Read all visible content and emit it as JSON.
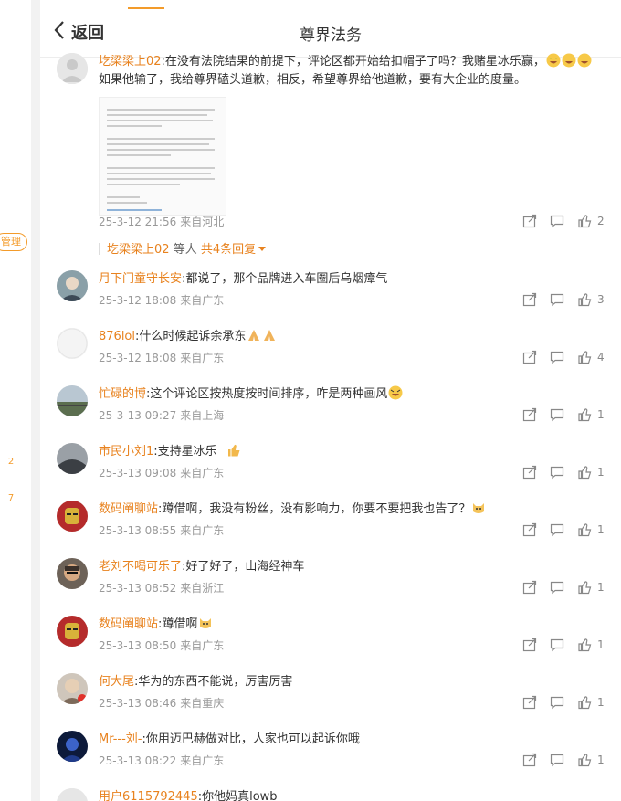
{
  "header": {
    "back_label": "返回",
    "title": "尊界法务"
  },
  "gutter": {
    "manage_label": "管理",
    "count_a": "2",
    "count_b": "7"
  },
  "comments": [
    {
      "user": "圪梁梁上02",
      "text": ":在没有法院结果的前提下，评论区都开始给扣帽子了吗？我赌星冰乐赢，",
      "text2": "如果他输了，我给尊界磕头道歉，相反，希望尊界给他道歉，要有大企业的度量。",
      "time": "25-3-12 21:56",
      "place": "来自河北",
      "likes": "2",
      "replies_user": "圪梁梁上02",
      "replies_mid": "等人",
      "replies_more": "共4条回复"
    },
    {
      "user": "月下门童守长安",
      "text": ":都说了，那个品牌进入车圈后乌烟瘴气",
      "time": "25-3-12 18:08",
      "place": "来自广东",
      "likes": "3"
    },
    {
      "user": "876lol",
      "text": ":什么时候起诉余承东",
      "time": "25-3-12 18:08",
      "place": "来自广东",
      "likes": "4"
    },
    {
      "user": "忙碌的博",
      "text": ":这个评论区按热度按时间排序，咋是两种画风",
      "time": "25-3-13 09:27",
      "place": "来自上海",
      "likes": "1"
    },
    {
      "user": "市民小刘1",
      "text": ":支持星冰乐",
      "time": "25-3-13 09:08",
      "place": "来自广东",
      "likes": "1"
    },
    {
      "user": "数码阐聊站",
      "text": ":蹲借啊，我没有粉丝，没有影响力，你要不要把我也告了？",
      "time": "25-3-13 08:55",
      "place": "来自广东",
      "likes": "1"
    },
    {
      "user": "老刘不喝可乐了",
      "text": ":好了好了，山海经神车",
      "time": "25-3-13 08:52",
      "place": "来自浙江",
      "likes": "1"
    },
    {
      "user": "数码阐聊站",
      "text": ":蹲借啊",
      "time": "25-3-13 08:50",
      "place": "来自广东",
      "likes": "1"
    },
    {
      "user": "何大尾",
      "text": ":华为的东西不能说，厉害厉害",
      "time": "25-3-13 08:46",
      "place": "来自重庆",
      "likes": "1"
    },
    {
      "user": "Mr---刘-",
      "text": ":你用迈巴赫做对比，人家也可以起诉你哦",
      "time": "25-3-13 08:22",
      "place": "来自广东",
      "likes": "1"
    },
    {
      "user": "用户6115792445",
      "text": ":你他妈真lowb"
    }
  ],
  "colors": {
    "accent": "#e8821e",
    "meta": "#999999",
    "text": "#333333"
  }
}
